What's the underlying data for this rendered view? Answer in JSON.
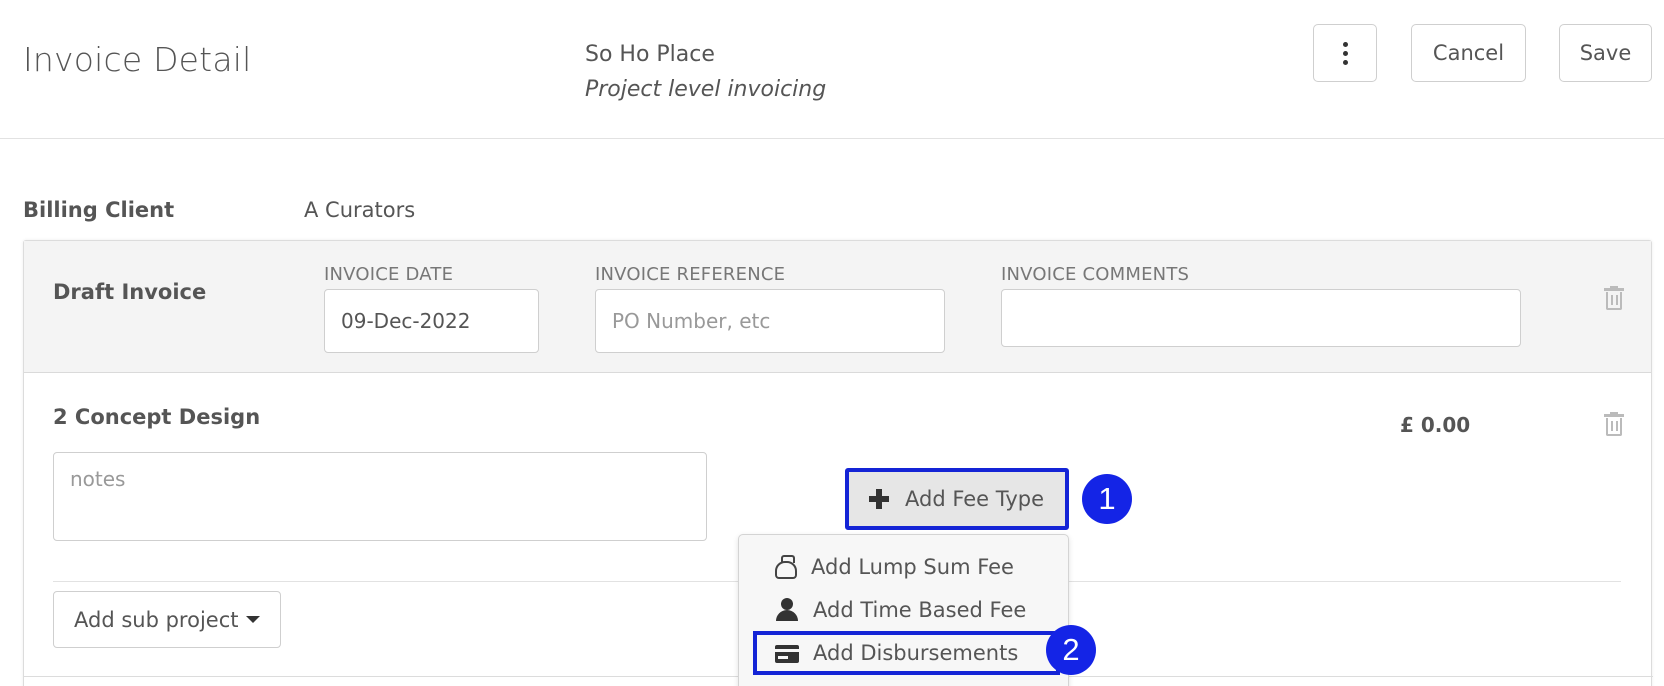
{
  "header": {
    "title": "Invoice Detail",
    "project_name": "So Ho Place",
    "project_subtitle": "Project level invoicing",
    "cancel_label": "Cancel",
    "save_label": "Save"
  },
  "billing": {
    "label": "Billing Client",
    "value": "A Curators"
  },
  "draft_invoice": {
    "title": "Draft Invoice",
    "date_label": "INVOICE DATE",
    "date_value": "09-Dec-2022",
    "reference_label": "INVOICE REFERENCE",
    "reference_placeholder": "PO Number, etc",
    "comments_label": "INVOICE COMMENTS",
    "comments_value": ""
  },
  "sub_project": {
    "title": "2 Concept Design",
    "amount": "£ 0.00",
    "notes_placeholder": "notes",
    "add_fee_type_label": "Add Fee Type",
    "add_sub_project_label": "Add sub project"
  },
  "fee_menu": {
    "items": [
      {
        "label": "Add Lump Sum Fee",
        "icon": "money-bag-icon"
      },
      {
        "label": "Add Time Based Fee",
        "icon": "person-icon"
      },
      {
        "label": "Add Disbursements",
        "icon": "credit-card-icon"
      }
    ]
  },
  "annotations": {
    "marker_1": "1",
    "marker_2": "2",
    "highlight_color": "#1424d6"
  }
}
